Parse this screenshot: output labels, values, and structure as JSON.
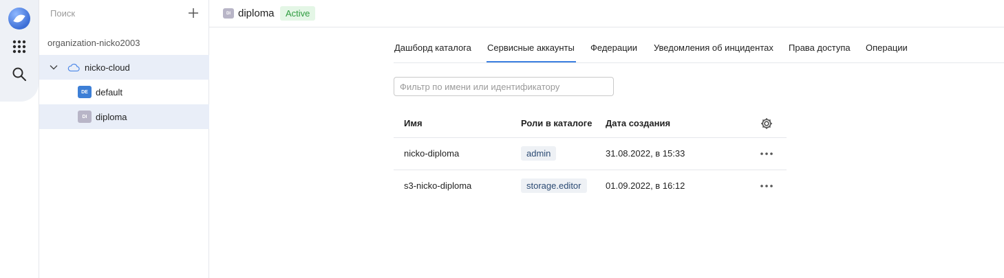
{
  "sidebar": {
    "search_placeholder": "Поиск",
    "organization": "organization-nicko2003",
    "cloud": {
      "label": "nicko-cloud"
    },
    "folders": [
      {
        "badge": "DE",
        "label": "default",
        "color": "#3d7fd6"
      },
      {
        "badge": "DI",
        "label": "diploma",
        "color": "#b8b5c7"
      }
    ]
  },
  "header": {
    "badge": "DI",
    "title": "diploma",
    "status": "Active"
  },
  "tabs": [
    {
      "label": "Дашборд каталога",
      "active": false
    },
    {
      "label": "Сервисные аккаунты",
      "active": true
    },
    {
      "label": "Федерации",
      "active": false
    },
    {
      "label": "Уведомления об инцидентах",
      "active": false
    },
    {
      "label": "Права доступа",
      "active": false
    },
    {
      "label": "Операции",
      "active": false
    }
  ],
  "filter": {
    "placeholder": "Фильтр по имени или идентификатору",
    "value": ""
  },
  "table": {
    "columns": [
      "Имя",
      "Роли в каталоге",
      "Дата создания"
    ],
    "rows": [
      {
        "name": "nicko-diploma",
        "role": "admin",
        "created": "31.08.2022, в 15:33"
      },
      {
        "name": "s3-nicko-diploma",
        "role": "storage.editor",
        "created": "01.09.2022, в 16:12"
      }
    ]
  },
  "colors": {
    "accent": "#3b7fe0",
    "status_bg": "#e4f6e6",
    "status_text": "#2d9b3e",
    "selected_row": "#e9eef8"
  }
}
